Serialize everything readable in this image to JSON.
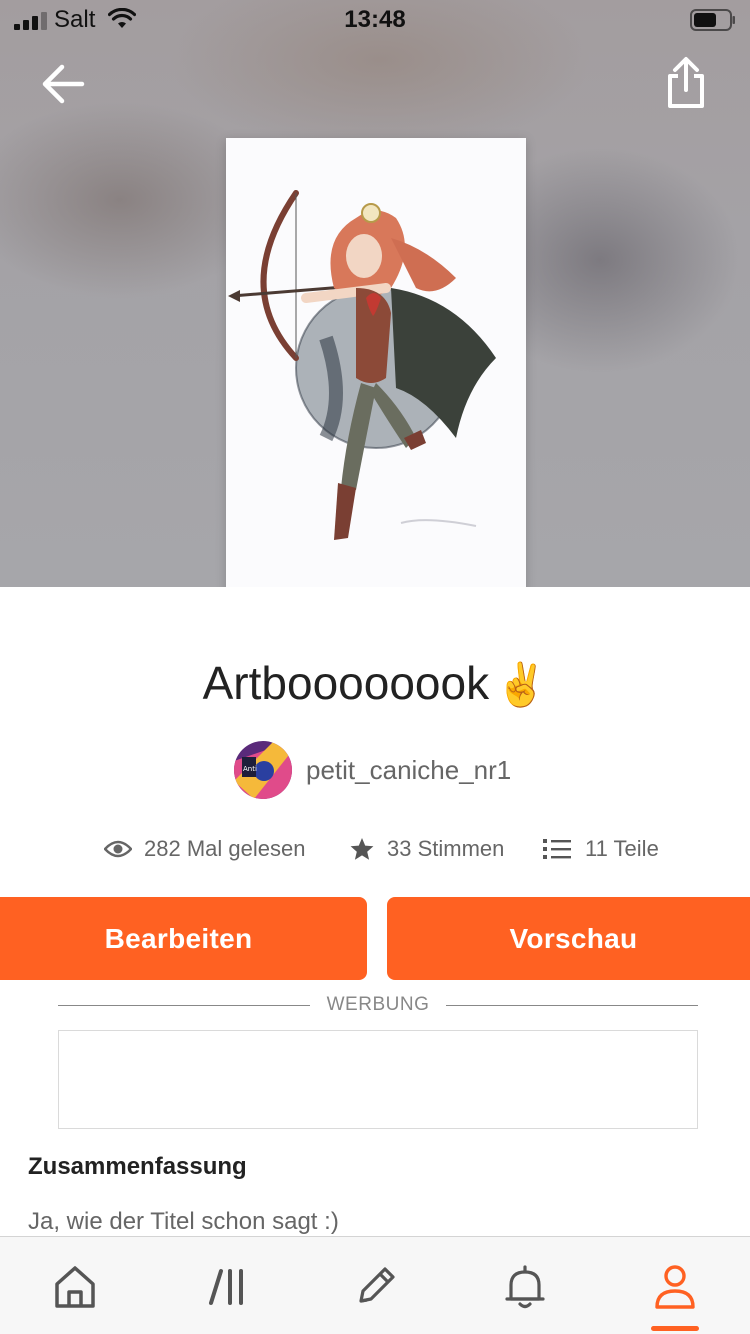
{
  "status_bar": {
    "carrier": "Salt",
    "time": "13:48"
  },
  "header": {
    "back_icon": "arrow-left-icon",
    "share_icon": "share-icon"
  },
  "story": {
    "title": "Artboooooook",
    "title_emoji": "✌️",
    "author": "petit_caniche_nr1",
    "stats": {
      "reads": "282 Mal gelesen",
      "votes": "33 Stimmen",
      "parts": "11 Teile"
    }
  },
  "actions": {
    "edit_label": "Bearbeiten",
    "preview_label": "Vorschau"
  },
  "ad": {
    "label": "WERBUNG"
  },
  "summary": {
    "heading": "Zusammenfassung",
    "text": "Ja, wie der Titel schon sagt :)"
  },
  "tabbar": {
    "items": [
      "home-icon",
      "library-icon",
      "write-icon",
      "notifications-icon",
      "profile-icon"
    ],
    "active": "profile-icon"
  },
  "colors": {
    "accent": "#ff6122",
    "text_primary": "#222222",
    "text_secondary": "#666666"
  }
}
